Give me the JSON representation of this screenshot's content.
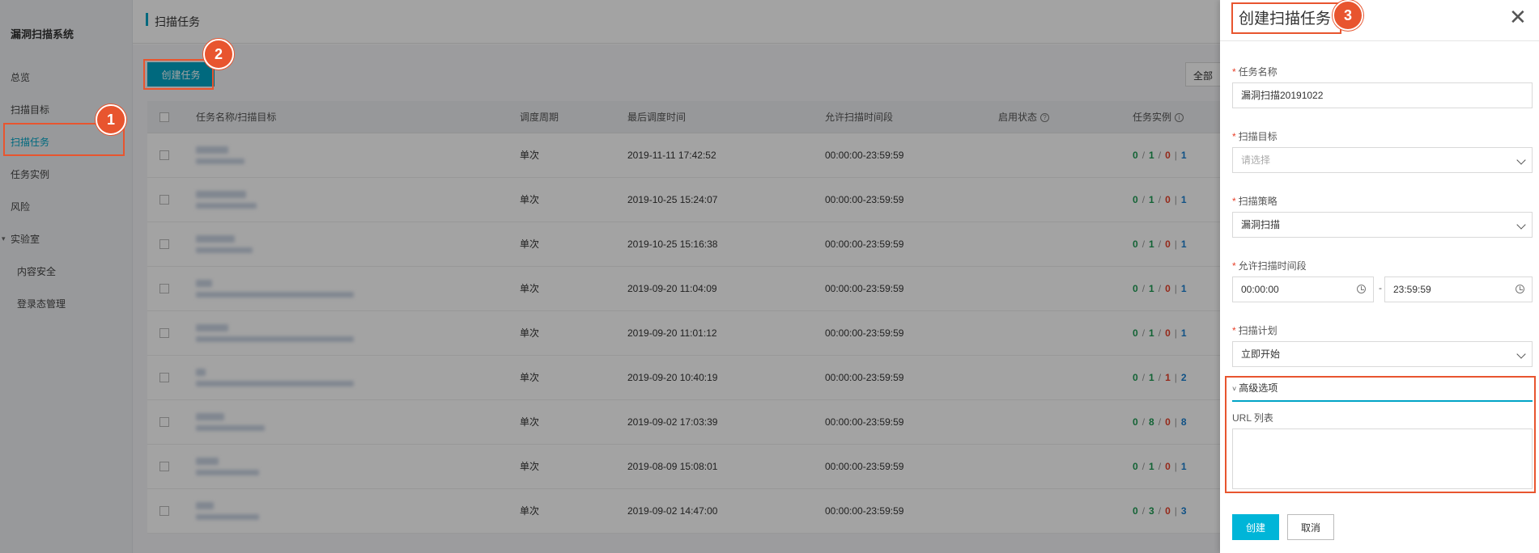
{
  "sidebar": {
    "title": "漏洞扫描系统",
    "items": [
      {
        "label": "总览"
      },
      {
        "label": "扫描目标"
      },
      {
        "label": "扫描任务",
        "active": true
      },
      {
        "label": "任务实例"
      },
      {
        "label": "风险"
      },
      {
        "label": "实验室"
      },
      {
        "label": "内容安全"
      },
      {
        "label": "登录态管理"
      }
    ]
  },
  "header": {
    "breadcrumb": "扫描任务"
  },
  "toolbar": {
    "create_label": "创建任务",
    "filter_label": "全部"
  },
  "table": {
    "columns": [
      "任务名称/扫描目标",
      "调度周期",
      "最后调度时间",
      "允许扫描时间段",
      "启用状态",
      "任务实例"
    ],
    "rows": [
      {
        "period": "单次",
        "last_time": "2019-11-11 17:42:52",
        "window": "00:00:00-23:59:59",
        "counts": [
          "0",
          "1",
          "0",
          "1"
        ]
      },
      {
        "period": "单次",
        "last_time": "2019-10-25 15:24:07",
        "window": "00:00:00-23:59:59",
        "counts": [
          "0",
          "1",
          "0",
          "1"
        ]
      },
      {
        "period": "单次",
        "last_time": "2019-10-25 15:16:38",
        "window": "00:00:00-23:59:59",
        "counts": [
          "0",
          "1",
          "0",
          "1"
        ]
      },
      {
        "period": "单次",
        "last_time": "2019-09-20 11:04:09",
        "window": "00:00:00-23:59:59",
        "counts": [
          "0",
          "1",
          "0",
          "1"
        ]
      },
      {
        "period": "单次",
        "last_time": "2019-09-20 11:01:12",
        "window": "00:00:00-23:59:59",
        "counts": [
          "0",
          "1",
          "0",
          "1"
        ]
      },
      {
        "period": "单次",
        "last_time": "2019-09-20 10:40:19",
        "window": "00:00:00-23:59:59",
        "counts": [
          "0",
          "1",
          "1",
          "2"
        ]
      },
      {
        "period": "单次",
        "last_time": "2019-09-02 17:03:39",
        "window": "00:00:00-23:59:59",
        "counts": [
          "0",
          "8",
          "0",
          "8"
        ]
      },
      {
        "period": "单次",
        "last_time": "2019-08-09 15:08:01",
        "window": "00:00:00-23:59:59",
        "counts": [
          "0",
          "1",
          "0",
          "1"
        ]
      },
      {
        "period": "单次",
        "last_time": "2019-09-02 14:47:00",
        "window": "00:00:00-23:59:59",
        "counts": [
          "0",
          "3",
          "0",
          "3"
        ]
      }
    ]
  },
  "drawer": {
    "title": "创建扫描任务",
    "fields": {
      "task_name": {
        "label": "任务名称",
        "value": "漏洞扫描20191022"
      },
      "target": {
        "label": "扫描目标",
        "placeholder": "请选择"
      },
      "policy": {
        "label": "扫描策略",
        "value": "漏洞扫描"
      },
      "window": {
        "label": "允许扫描时间段",
        "start": "00:00:00",
        "sep": "-",
        "end": "23:59:59"
      },
      "plan": {
        "label": "扫描计划",
        "value": "立即开始"
      }
    },
    "advanced": {
      "label": "高级选项",
      "url_label": "URL 列表"
    },
    "create_label": "创建",
    "cancel_label": "取消"
  },
  "callouts": [
    "1",
    "2",
    "3"
  ],
  "colors": {
    "accent": "#00a4c6",
    "callout": "#e8552f",
    "green": "#1e9c54",
    "red": "#e8402a",
    "blue": "#1a7fd0"
  }
}
